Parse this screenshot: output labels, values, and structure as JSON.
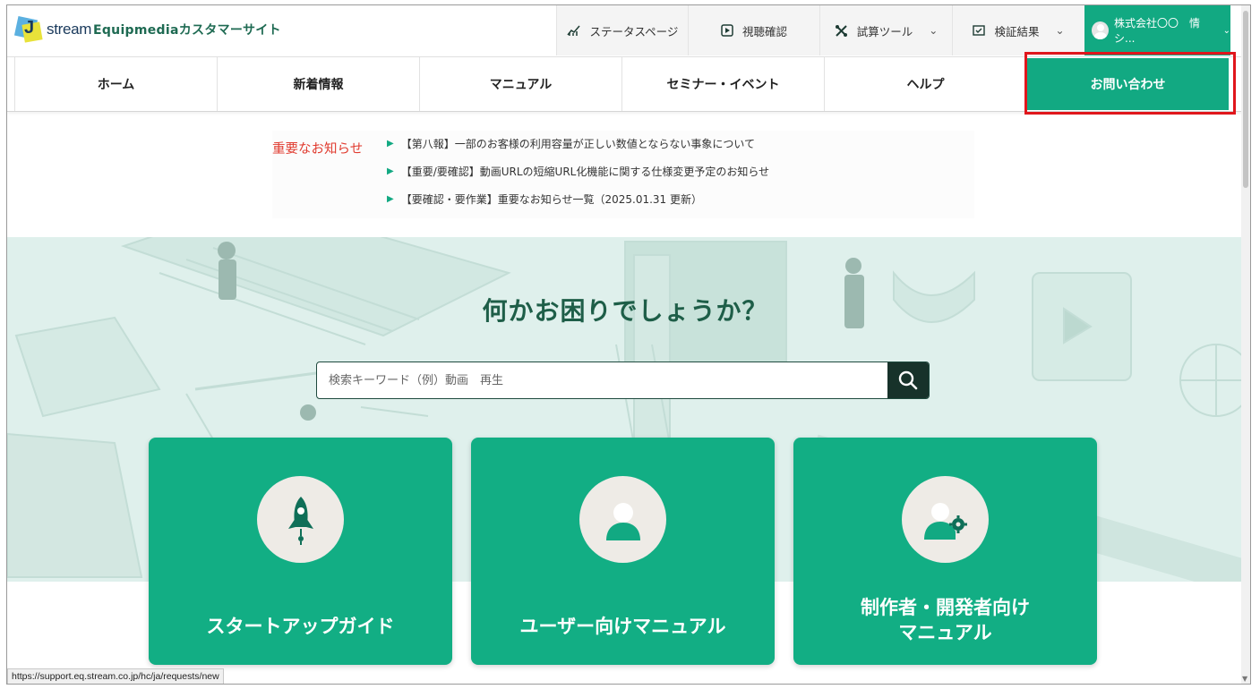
{
  "brand": {
    "logo_text": "stream",
    "logo_letter": "J",
    "site_name": "Equipmediaカスタマーサイト"
  },
  "utility": {
    "status": "ステータスページ",
    "viewing": "視聴確認",
    "trial": "試算ツール",
    "verify": "検証結果",
    "account": "株式会社〇〇　情シ..."
  },
  "nav": [
    "ホーム",
    "新着情報",
    "マニュアル",
    "セミナー・イベント",
    "ヘルプ",
    "お問い合わせ"
  ],
  "notices": {
    "label": "重要なお知らせ",
    "items": [
      "【第八報】一部のお客様の利用容量が正しい数値とならない事象について",
      "【重要/要確認】動画URLの短縮URL化機能に関する仕様変更予定のお知らせ",
      "【要確認・要作業】重要なお知らせ一覧（2025.01.31 更新）"
    ]
  },
  "hero": {
    "title": "何かお困りでしょうか？",
    "search_placeholder": "検索キーワード（例）動画　再生"
  },
  "cards": [
    {
      "label": "スタートアップガイド"
    },
    {
      "label": "ユーザー向けマニュアル"
    },
    {
      "label_line1": "制作者・開発者向け",
      "label_line2": "マニュアル"
    }
  ],
  "status_url": "https://support.eq.stream.co.jp/hc/ja/requests/new",
  "colors": {
    "brand_green": "#12a982",
    "dark_green": "#1e5e48",
    "alert_red": "#e03a2e",
    "highlight_red": "#e0161c"
  }
}
